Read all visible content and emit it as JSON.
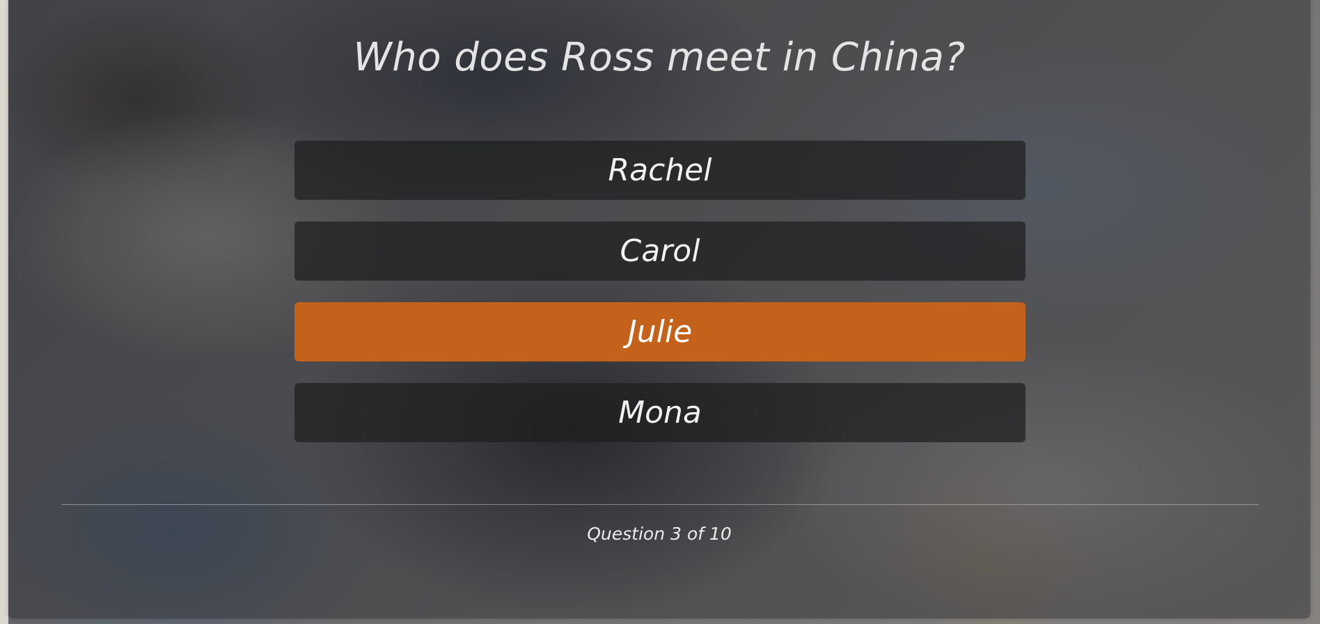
{
  "quiz": {
    "question": "Who does Ross meet in China?",
    "answers": [
      {
        "label": "Rachel",
        "selected": false
      },
      {
        "label": "Carol",
        "selected": false
      },
      {
        "label": "Julie",
        "selected": true
      },
      {
        "label": "Mona",
        "selected": false
      }
    ],
    "progress_text": "Question 3 of 10",
    "progress": {
      "current": 3,
      "total": 10
    }
  },
  "colors": {
    "selected_accent": "#c4621c",
    "answer_background": "#1e1e20",
    "text": "#f2f2f2"
  }
}
